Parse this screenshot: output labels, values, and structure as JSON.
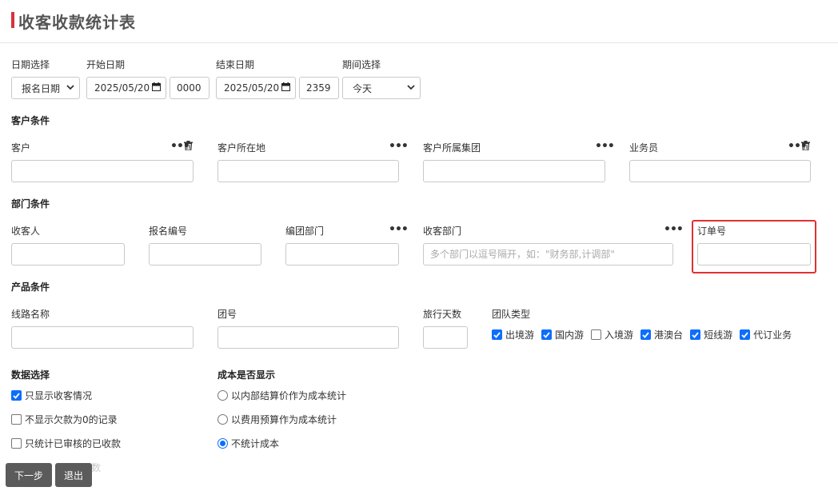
{
  "page": {
    "title": "收客收款统计表"
  },
  "date_row": {
    "date_select_label": "日期选择",
    "date_select_value": "报名日期",
    "start_label": "开始日期",
    "start_date": "2025/05/20",
    "start_time": "0000",
    "end_label": "结束日期",
    "end_date": "2025/05/20",
    "end_time": "2359",
    "period_label": "期间选择",
    "period_value": "今天"
  },
  "customer_section": {
    "title": "客户条件",
    "customer_label": "客户",
    "location_label": "客户所在地",
    "group_label": "客户所属集团",
    "salesman_label": "业务员"
  },
  "department_section": {
    "title": "部门条件",
    "receiver_label": "收客人",
    "signup_no_label": "报名编号",
    "team_dept_label": "编团部门",
    "recv_dept_label": "收客部门",
    "recv_dept_placeholder": "多个部门以逗号隔开，如：\"财务部,计调部\"",
    "order_no_label": "订单号"
  },
  "product_section": {
    "title": "产品条件",
    "route_label": "线路名称",
    "group_no_label": "团号",
    "days_label": "旅行天数",
    "team_type_label": "团队类型",
    "team_types": [
      {
        "label": "出境游",
        "checked": true
      },
      {
        "label": "国内游",
        "checked": true
      },
      {
        "label": "入境游",
        "checked": false
      },
      {
        "label": "港澳台",
        "checked": true
      },
      {
        "label": "短线游",
        "checked": true
      },
      {
        "label": "代订业务",
        "checked": true
      }
    ]
  },
  "data_section": {
    "title": "数据选择",
    "options": [
      {
        "label": "只显示收客情况",
        "checked": true
      },
      {
        "label": "不显示欠款为0的记录",
        "checked": false
      },
      {
        "label": "只统计已审核的已收款",
        "checked": false
      }
    ],
    "faded_text": "数"
  },
  "cost_section": {
    "title": "成本是否显示",
    "options": [
      {
        "label": "以内部结算价作为成本统计",
        "selected": false
      },
      {
        "label": "以费用预算作为成本统计",
        "selected": false
      },
      {
        "label": "不统计成本",
        "selected": true
      }
    ]
  },
  "buttons": {
    "next": "下一步",
    "exit": "退出"
  },
  "colors": {
    "accent": "#d6333a",
    "highlight": "#e03131",
    "checkbox": "#0d6efd",
    "button": "#5b5b5b"
  }
}
